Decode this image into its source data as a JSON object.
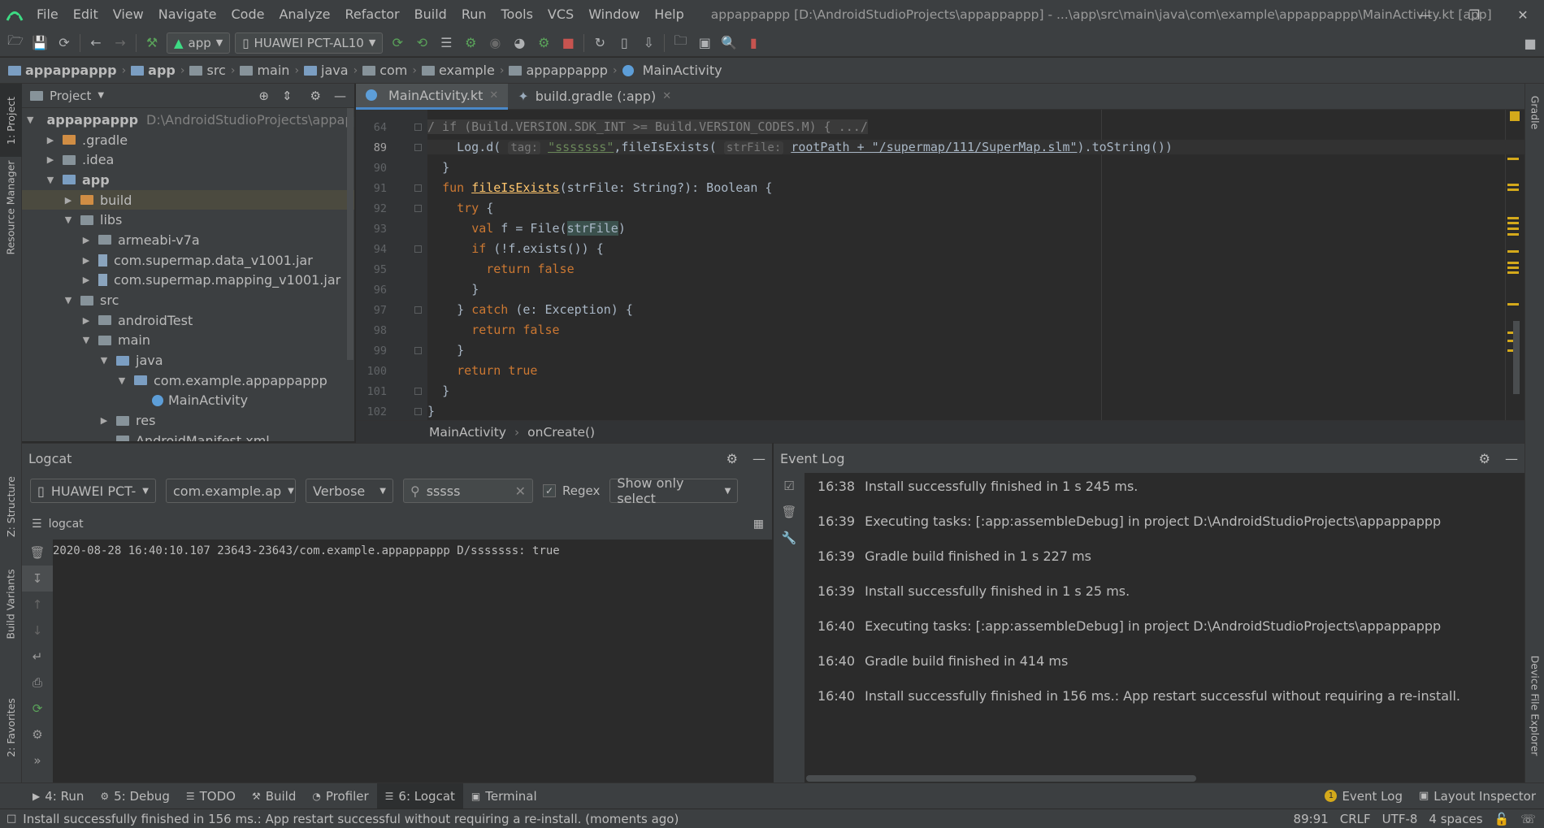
{
  "menubar": {
    "items": [
      "File",
      "Edit",
      "View",
      "Navigate",
      "Code",
      "Analyze",
      "Refactor",
      "Build",
      "Run",
      "Tools",
      "VCS",
      "Window",
      "Help"
    ],
    "window_title": "appappappp [D:\\AndroidStudioProjects\\appappappp] - ...\\app\\src\\main\\java\\com\\example\\appappappp\\MainActivity.kt [app]"
  },
  "toolbar": {
    "run_config": "app",
    "device": "HUAWEI PCT-AL10"
  },
  "breadcrumb": [
    "appappappp",
    "app",
    "src",
    "main",
    "java",
    "com",
    "example",
    "appappappp",
    "MainActivity"
  ],
  "project_panel": {
    "title": "Project",
    "tree": [
      {
        "label": "appappappp",
        "path": "D:\\AndroidStudioProjects\\appappapp",
        "indent": 0,
        "arrow": "down",
        "bold": true
      },
      {
        "label": ".gradle",
        "indent": 1,
        "arrow": "right"
      },
      {
        "label": ".idea",
        "indent": 1,
        "arrow": "right"
      },
      {
        "label": "app",
        "indent": 1,
        "arrow": "down",
        "bold": true
      },
      {
        "label": "build",
        "indent": 2,
        "arrow": "right",
        "selected": true
      },
      {
        "label": "libs",
        "indent": 2,
        "arrow": "down"
      },
      {
        "label": "armeabi-v7a",
        "indent": 3,
        "arrow": "right"
      },
      {
        "label": "com.supermap.data_v1001.jar",
        "indent": 3,
        "arrow": "right",
        "jar": true
      },
      {
        "label": "com.supermap.mapping_v1001.jar",
        "indent": 3,
        "arrow": "right",
        "jar": true
      },
      {
        "label": "src",
        "indent": 2,
        "arrow": "down"
      },
      {
        "label": "androidTest",
        "indent": 3,
        "arrow": "right"
      },
      {
        "label": "main",
        "indent": 3,
        "arrow": "down"
      },
      {
        "label": "java",
        "indent": 4,
        "arrow": "down"
      },
      {
        "label": "com.example.appappappp",
        "indent": 5,
        "arrow": "down"
      },
      {
        "label": "MainActivity",
        "indent": 6,
        "arrow": "",
        "kotlin": true
      },
      {
        "label": "res",
        "indent": 4,
        "arrow": "right"
      },
      {
        "label": "AndroidManifest.xml",
        "indent": 4,
        "arrow": ""
      }
    ]
  },
  "editor": {
    "tabs": [
      {
        "label": "MainActivity.kt",
        "active": true
      },
      {
        "label": "build.gradle (:app)",
        "active": false
      }
    ],
    "line_numbers": [
      "64",
      "89",
      "90",
      "91",
      "92",
      "93",
      "94",
      "95",
      "96",
      "97",
      "98",
      "99",
      "100",
      "101",
      "102"
    ],
    "code": {
      "l64": "/ if (Build.VERSION.SDK_INT >= Build.VERSION_CODES.M) { .../",
      "l89_a": "Log.d(",
      "l89_hint_tag": "tag:",
      "l89_str": "\"sssssss\"",
      "l89_b": ",fileIsExists(",
      "l89_hint_strfile": "strFile:",
      "l89_c": "rootPath + \"/supermap/111/SuperMap.slm\"",
      "l89_d": ").toString())",
      "l90": "}",
      "l91_kw": "fun",
      "l91_fn": "fileIsExists",
      "l91_rest": "(strFile: String?): Boolean {",
      "l92_kw": "try",
      "l92_rest": " {",
      "l93_kw": "val",
      "l93_a": " f = File(",
      "l93_var": "strFile",
      "l93_b": ")",
      "l94_kw": "if",
      "l94_rest": " (!f.exists()) {",
      "l95_kw": "return",
      "l95_kw2": "false",
      "l96": "}",
      "l97_a": "} ",
      "l97_kw": "catch",
      "l97_rest": " (e: Exception) {",
      "l98_kw": "return",
      "l98_kw2": "false",
      "l99": "}",
      "l100_kw": "return",
      "l100_kw2": "true",
      "l101": "}",
      "l102": "}"
    },
    "breadcrumb": [
      "MainActivity",
      "onCreate()"
    ]
  },
  "logcat": {
    "title": "Logcat",
    "device": "HUAWEI PCT-",
    "package": "com.example.ap",
    "level": "Verbose",
    "search": "sssss",
    "regex_label": "Regex",
    "regex_checked": true,
    "filter": "Show only select",
    "tab_label": "logcat",
    "lines": [
      "2020-08-28 16:40:10.107 23643-23643/com.example.appappappp D/sssssss: true"
    ]
  },
  "event_log": {
    "title": "Event Log",
    "entries": [
      {
        "time": "16:38",
        "text": "Install successfully finished in 1 s 245 ms."
      },
      {
        "time": "16:39",
        "text": "Executing tasks: [:app:assembleDebug] in project D:\\AndroidStudioProjects\\appappappp"
      },
      {
        "time": "16:39",
        "text": "Gradle build finished in 1 s 227 ms"
      },
      {
        "time": "16:39",
        "text": "Install successfully finished in 1 s 25 ms."
      },
      {
        "time": "16:40",
        "text": "Executing tasks: [:app:assembleDebug] in project D:\\AndroidStudioProjects\\appappappp"
      },
      {
        "time": "16:40",
        "text": "Gradle build finished in 414 ms"
      },
      {
        "time": "16:40",
        "text": "Install successfully finished in 156 ms.: App restart successful without requiring a re-install."
      }
    ]
  },
  "bottom_tabs": [
    {
      "label": "4: Run",
      "icon": "run-icon"
    },
    {
      "label": "5: Debug",
      "icon": "debug-icon"
    },
    {
      "label": "TODO",
      "icon": "todo-icon"
    },
    {
      "label": "Build",
      "icon": "build-icon"
    },
    {
      "label": "Profiler",
      "icon": "profiler-icon"
    },
    {
      "label": "6: Logcat",
      "icon": "logcat-icon",
      "active": true
    },
    {
      "label": "Terminal",
      "icon": "terminal-icon"
    }
  ],
  "bottom_right_tabs": [
    {
      "label": "Event Log",
      "icon": "event-log-icon",
      "badge": "1"
    },
    {
      "label": "Layout Inspector",
      "icon": "layout-inspector-icon"
    }
  ],
  "side_tabs": {
    "left": [
      "1: Project",
      "Resource Manager",
      "Z: Structure",
      "Build Variants",
      "2: Favorites"
    ],
    "right": [
      "Gradle",
      "Device File Explorer"
    ]
  },
  "statusbar": {
    "message": "Install successfully finished in 156 ms.: App restart successful without requiring a re-install. (moments ago)",
    "position": "89:91",
    "line_sep": "CRLF",
    "encoding": "UTF-8",
    "indent": "4 spaces"
  },
  "colors": {
    "keyword": "#cc7832",
    "string": "#6a8759",
    "function": "#ffc66d",
    "accent": "#4a88c7",
    "background": "#2b2b2b",
    "panel": "#3c3f41"
  }
}
